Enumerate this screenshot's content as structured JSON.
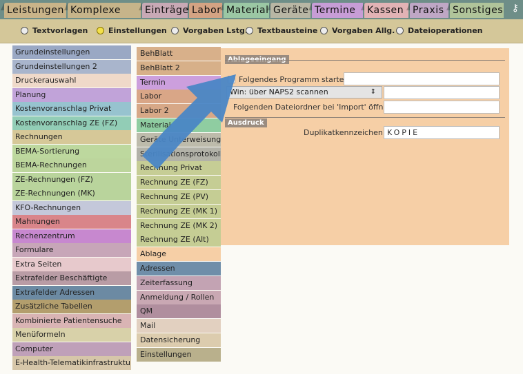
{
  "top_tabs": [
    {
      "label": "Leistungen",
      "color": "#c9b489"
    },
    {
      "label": "Komplexe POA",
      "color": "#c6b48a"
    },
    {
      "label": "Einträge",
      "color": "#c8a9b5"
    },
    {
      "label": "Labor",
      "color": "#d4a383"
    },
    {
      "label": "Material",
      "color": "#9bc7a4"
    },
    {
      "label": "Geräte",
      "color": "#b8b6a4"
    },
    {
      "label": "Termine",
      "color": "#c79dd6"
    },
    {
      "label": "Kassen",
      "color": "#e2b3b5"
    },
    {
      "label": "Praxis",
      "color": "#bfa7c5"
    },
    {
      "label": "Sonstiges",
      "color": "#b0c49a"
    }
  ],
  "corner_icon": "key-icon",
  "radio_options": [
    {
      "label": "Textvorlagen",
      "selected": false
    },
    {
      "label": "Einstellungen",
      "selected": true
    },
    {
      "label": "Vorgaben Lstg.",
      "selected": false
    },
    {
      "label": "Textbausteine",
      "selected": false
    },
    {
      "label": "Vorgaben Allg.",
      "selected": false
    },
    {
      "label": "Dateioperationen",
      "selected": false
    }
  ],
  "left_items": [
    {
      "label": "Grundeinstellungen",
      "color": "#9aa8c4"
    },
    {
      "label": "Grundeinstellungen 2",
      "color": "#a9b5cc"
    },
    {
      "label": "Druckerauswahl",
      "color": "#efd9c9"
    },
    {
      "label": "Planung",
      "color": "#c1a3d9"
    },
    {
      "label": "Kostenvoranschlag Privat",
      "color": "#97c3cf"
    },
    {
      "label": "Kostenvoranschlag ZE (FZ)",
      "color": "#92cdb6"
    },
    {
      "label": "Rechnungen",
      "color": "#d6c898"
    },
    {
      "label": "BEMA-Sortierung",
      "color": "#bdd89e"
    },
    {
      "label": "BEMA-Rechnungen",
      "color": "#bcd59c"
    },
    {
      "label": "ZE-Rechnungen (FZ)",
      "color": "#b9d49c"
    },
    {
      "label": "ZE-Rechnungen (MK)",
      "color": "#b9d49c"
    },
    {
      "label": "KFO-Rechnungen",
      "color": "#c4c8da"
    },
    {
      "label": "Mahnungen",
      "color": "#d9858a"
    },
    {
      "label": "Rechenzentrum",
      "color": "#c788cf"
    },
    {
      "label": "Formulare",
      "color": "#c7a6b8"
    },
    {
      "label": "Extra Seiten",
      "color": "#e7c9cc"
    },
    {
      "label": "Extrafelder Beschäftigte",
      "color": "#b99ca5"
    },
    {
      "label": "Extrafelder Adressen",
      "color": "#6c8aa3"
    },
    {
      "label": "Zusätzliche Tabellen",
      "color": "#b39e6d"
    },
    {
      "label": "Kombinierte Patientensuche",
      "color": "#d9b4b4"
    },
    {
      "label": "Menüformeln",
      "color": "#d8d1a9"
    },
    {
      "label": "Computer",
      "color": "#bfa0b9"
    },
    {
      "label": "E-Health-Telematikinfrastruktur",
      "color": "#d6c6a9"
    }
  ],
  "mid_items": [
    {
      "label": "BehBlatt",
      "color": "#d8b08a"
    },
    {
      "label": "BehBlatt 2",
      "color": "#d7b089"
    },
    {
      "label": "Termin",
      "color": "#cc9fdd"
    },
    {
      "label": "Labor",
      "color": "#d9a687"
    },
    {
      "label": "Labor 2",
      "color": "#d7a887"
    },
    {
      "label": "Material",
      "color": "#8fcda1"
    },
    {
      "label": "Geräte Unterweisung / Rente",
      "color": "#bdbbab"
    },
    {
      "label": "Sterilisationsprotokoll",
      "color": "#b2b2a8"
    },
    {
      "label": "Rechnung Privat",
      "color": "#c6cd95"
    },
    {
      "label": "Rechnung ZE (FZ)",
      "color": "#c5cd94"
    },
    {
      "label": "Rechnung ZE (PV)",
      "color": "#c5cd94"
    },
    {
      "label": "Rechnung ZE (MK 1)",
      "color": "#c5cd94"
    },
    {
      "label": "Rechnung ZE (MK 2)",
      "color": "#c5cd94"
    },
    {
      "label": "Rechnung ZE (Alt)",
      "color": "#c5cd94"
    },
    {
      "label": "Ablage",
      "color": "#f6cfa6"
    },
    {
      "label": "Adressen",
      "color": "#6f8ea9"
    },
    {
      "label": "Zeiterfassung",
      "color": "#c3a3b3"
    },
    {
      "label": "Anmeldung / Rollen",
      "color": "#c9a8b3"
    },
    {
      "label": "QM",
      "color": "#b08e9e"
    },
    {
      "label": "Mail",
      "color": "#e2d0c0"
    },
    {
      "label": "Datensicherung",
      "color": "#dcccae"
    },
    {
      "label": "Einstellungen",
      "color": "#b9b08c"
    }
  ],
  "panel": {
    "section1_title": "Ablageeingang",
    "program_checkbox_label": "Folgendes Programm starten:",
    "program_value": "",
    "scan_select_value": "Win: über NAPS2 scannen",
    "scan_value": "",
    "import_folder_label": "Folgenden Dateiordner bei 'Import' öffnen:",
    "import_folder_value": "",
    "section2_title": "Ausdruck",
    "duplicate_label": "Duplikatkennzeichen:",
    "duplicate_value": "KOPIE"
  },
  "overlay": {
    "arrow_color": "#4a86c5"
  }
}
